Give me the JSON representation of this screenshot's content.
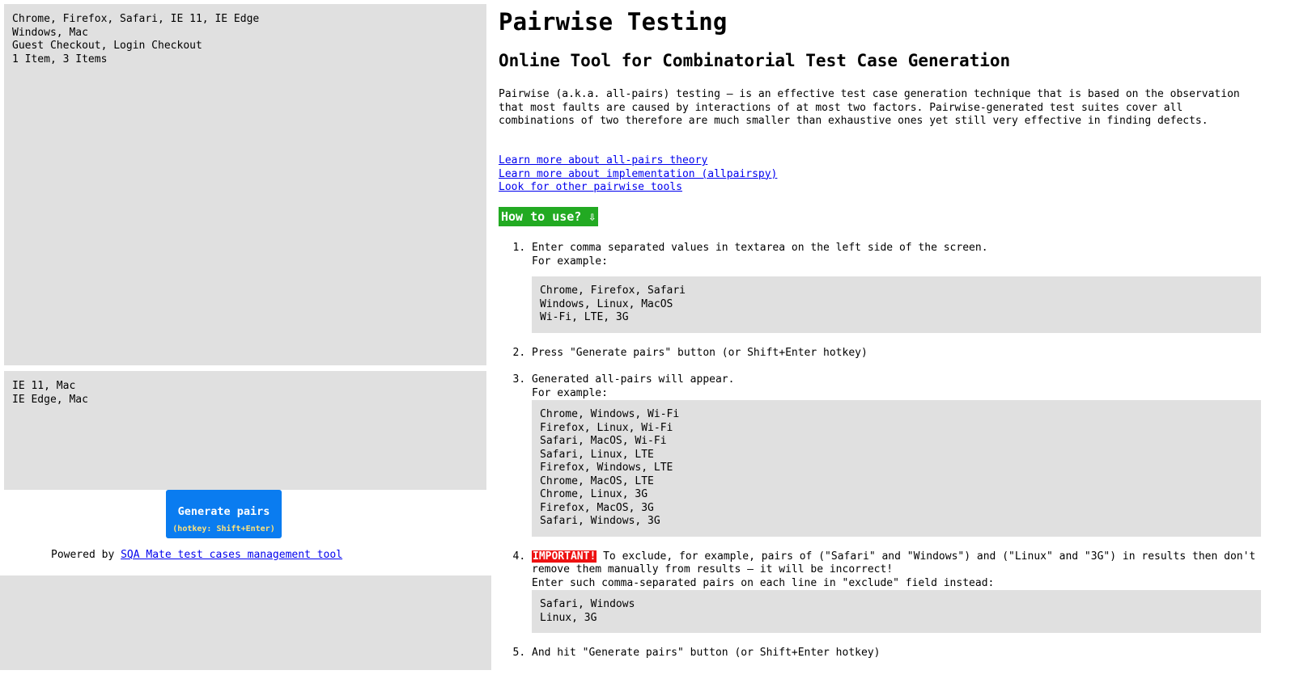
{
  "left": {
    "parameters_value": "Chrome, Firefox, Safari, IE 11, IE Edge\nWindows, Mac\nGuest Checkout, Login Checkout\n1 Item, 3 Items",
    "exclude_value": "IE 11, Mac\nIE Edge, Mac",
    "generate_button_label": "Generate pairs",
    "generate_button_hotkey": "(hotkey: Shift+Enter)",
    "powered_by_prefix": "Powered by ",
    "powered_by_link": "SQA Mate test cases management tool"
  },
  "right": {
    "title": "Pairwise Testing",
    "subtitle": "Online Tool for Combinatorial Test Case Generation",
    "intro": "Pairwise (a.k.a. all-pairs) testing — is an effective test case generation technique that is based on the observation that most faults are caused by interactions of at most two factors. Pairwise-generated test suites cover all combinations of two therefore are much smaller than exhaustive ones yet still very effective in finding defects.",
    "links": [
      "Learn more about all-pairs theory",
      "Learn more about implementation (allpairspy)",
      "Look for other pairwise tools"
    ],
    "howto_label": "How to use? ⇩",
    "steps": {
      "s1_line1": "Enter comma separated values in textarea on the left side of the screen.",
      "s1_line2": "For example:",
      "s1_example": "Chrome, Firefox, Safari\nWindows, Linux, MacOS\nWi-Fi, LTE, 3G",
      "s2": "Press \"Generate pairs\" button (or Shift+Enter hotkey)",
      "s3_line1": "Generated all-pairs will appear.",
      "s3_line2": "For example:",
      "s3_example": "Chrome, Windows, Wi-Fi\nFirefox, Linux, Wi-Fi\nSafari, MacOS, Wi-Fi\nSafari, Linux, LTE\nFirefox, Windows, LTE\nChrome, MacOS, LTE\nChrome, Linux, 3G\nFirefox, MacOS, 3G\nSafari, Windows, 3G",
      "s4_badge": "IMPORTANT!",
      "s4_text": " To exclude, for example, pairs of (\"Safari\" and \"Windows\") and (\"Linux\" and \"3G\") in results then don't remove them manually from results — it will be incorrect!",
      "s4_line2": "Enter such comma-separated pairs on each line in \"exclude\" field instead:",
      "s4_example": "Safari, Windows\nLinux, 3G",
      "s5": "And hit \"Generate pairs\" button (or Shift+Enter hotkey)"
    }
  },
  "colors": {
    "textarea_bg": "#e0e0e0",
    "button_bg": "#0a7cf0",
    "hotkey_text": "#ffe27a",
    "howto_bg": "#22aa22",
    "important_bg": "#ee1111",
    "link": "#0000ee"
  }
}
